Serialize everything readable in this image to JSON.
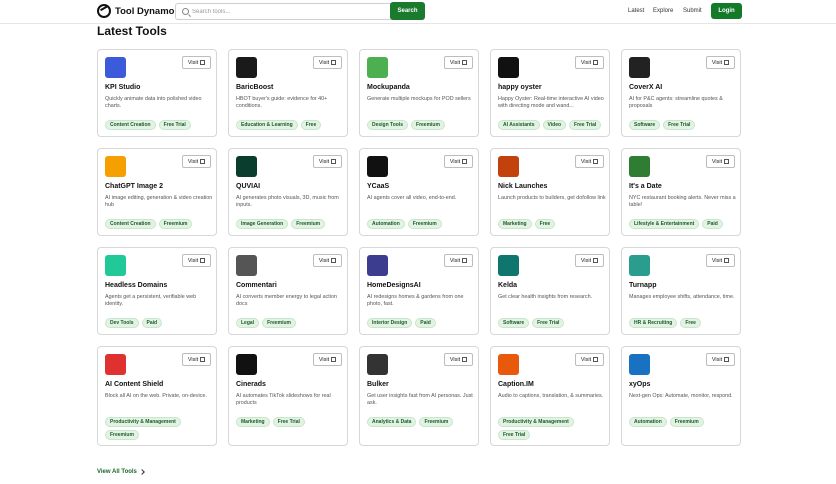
{
  "header": {
    "brand": "Tool Dynamo",
    "search_placeholder": "Search tools...",
    "search_button": "Search",
    "nav": [
      "Latest",
      "Explore",
      "Submit"
    ],
    "login": "Login"
  },
  "section_title": "Latest Tools",
  "visit_label": "Visit",
  "view_all": "View All Tools",
  "tools": [
    {
      "name": "KPI Studio",
      "desc": "Quickly animate data into polished video charts.",
      "tags": [
        "Content Creation",
        "Free Trial"
      ],
      "icon": "kpi-studio-logo-icon",
      "color": "#3b5bdb"
    },
    {
      "name": "BaricBoost",
      "desc": "HBOT buyer's guide: evidence for 40+ conditions.",
      "tags": [
        "Education & Learning",
        "Free"
      ],
      "icon": "bb-logo-icon",
      "color": "#1a1a1a"
    },
    {
      "name": "Mockupanda",
      "desc": "Generate multiple mockups for POD sellers",
      "tags": [
        "Design Tools",
        "Freemium"
      ],
      "icon": "panda-logo-icon",
      "color": "#4caf50"
    },
    {
      "name": "happy oyster",
      "desc": "Happy Oyster: Real-time interactive AI video with directing mode and wand...",
      "tags": [
        "AI Assistants",
        "Video",
        "Free Trial"
      ],
      "icon": "oyster-logo-icon",
      "color": "#111111"
    },
    {
      "name": "CoverX AI",
      "desc": "AI for P&C agents: streamline quotes & proposals",
      "tags": [
        "Software",
        "Free Trial"
      ],
      "icon": "shield-logo-icon",
      "color": "#222222"
    },
    {
      "name": "ChatGPT Image 2",
      "desc": "AI image editing, generation & video creation hub",
      "tags": [
        "Content Creation",
        "Freemium"
      ],
      "icon": "chatgpt-logo-icon",
      "color": "#f59f00"
    },
    {
      "name": "QUVIAI",
      "desc": "AI generates photo visuals, 3D, music from inputs.",
      "tags": [
        "Image Generation",
        "Freemium"
      ],
      "icon": "quviai-logo-icon",
      "color": "#0b3d2e"
    },
    {
      "name": "YCaaS",
      "desc": "AI agents cover all video, end-to-end.",
      "tags": [
        "Automation",
        "Freemium"
      ],
      "icon": "ycaas-logo-icon",
      "color": "#111111"
    },
    {
      "name": "Nick Launches",
      "desc": "Launch products to builders, get dofollow link",
      "tags": [
        "Marketing",
        "Free"
      ],
      "icon": "nick-launches-logo-icon",
      "color": "#c2410c"
    },
    {
      "name": "It's a Date",
      "desc": "NYC restaurant booking alerts. Never miss a table!",
      "tags": [
        "Lifestyle & Entertainment",
        "Paid"
      ],
      "icon": "date-logo-icon",
      "color": "#2e7d32"
    },
    {
      "name": "Headless Domains",
      "desc": "Agents get a persistent, verifiable web identity.",
      "tags": [
        "Dev Tools",
        "Paid"
      ],
      "icon": "headless-logo-icon",
      "color": "#20c997"
    },
    {
      "name": "Commentari",
      "desc": "AI converts member energy to legal action docs",
      "tags": [
        "Legal",
        "Freemium"
      ],
      "icon": "commentari-logo-icon",
      "color": "#555555"
    },
    {
      "name": "HomeDesignsAI",
      "desc": "AI redesigns homes & gardens from one photo, fast.",
      "tags": [
        "Interior Design",
        "Paid"
      ],
      "icon": "home-logo-icon",
      "color": "#3d3d8f"
    },
    {
      "name": "Kelda",
      "desc": "Get clear health insights from research.",
      "tags": [
        "Software",
        "Free Trial"
      ],
      "icon": "kelda-logo-icon",
      "color": "#0f766e"
    },
    {
      "name": "Turnapp",
      "desc": "Manages employee shifts, attendance, time.",
      "tags": [
        "HR & Recruiting",
        "Free"
      ],
      "icon": "turnapp-logo-icon",
      "color": "#2a9d8f"
    },
    {
      "name": "AI Content Shield",
      "desc": "Block all AI on the web. Private, on-device.",
      "tags": [
        "Productivity & Management",
        "Freemium"
      ],
      "icon": "ai-shield-logo-icon",
      "color": "#e03131"
    },
    {
      "name": "Cinerads",
      "desc": "AI automates TikTok slideshows for real products",
      "tags": [
        "Marketing",
        "Free Trial"
      ],
      "icon": "cinerads-logo-icon",
      "color": "#111111"
    },
    {
      "name": "Bulker",
      "desc": "Get user insights fast from AI personas. Just ask.",
      "tags": [
        "Analytics & Data",
        "Freemium"
      ],
      "icon": "bulker-logo-icon",
      "color": "#333333"
    },
    {
      "name": "Caption.IM",
      "desc": "Audio to captions, translation, & summaries.",
      "tags": [
        "Productivity & Management",
        "Free Trial"
      ],
      "icon": "caption-logo-icon",
      "color": "#e8590c"
    },
    {
      "name": "xyOps",
      "desc": "Next-gen Ops: Automate, monitor, respond.",
      "tags": [
        "Automation",
        "Freemium"
      ],
      "icon": "xyops-logo-icon",
      "color": "#1971c2"
    }
  ]
}
